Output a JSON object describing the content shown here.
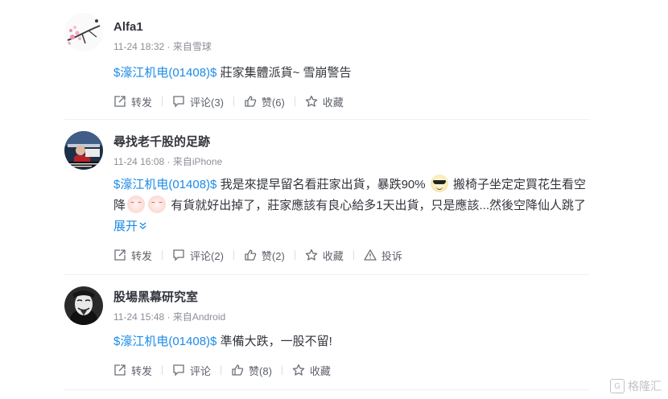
{
  "posts": [
    {
      "author": "Alfa1",
      "meta": "11-24 18:32 · 来自雪球",
      "stock": "$濠江机电(01408)$",
      "text_parts": [
        "莊家集體派貨~ 雪崩警告"
      ],
      "actions": {
        "repost": "转发",
        "comment": "评论(3)",
        "like": "赞(6)",
        "favorite": "收藏"
      }
    },
    {
      "author": "尋找老千股的足跡",
      "meta": "11-24 16:08 · 来自iPhone",
      "stock": "$濠江机电(01408)$",
      "text_parts": [
        "我是來提早留名看莊家出貨，暴跌90%",
        "搬椅子坐定定買花生看空降",
        "有貨就好出掉了，莊家應該有良心給多1天出貨，只是應該...然後空降仙人跳了"
      ],
      "expand": "展开",
      "actions": {
        "repost": "转发",
        "comment": "评论(2)",
        "like": "赞(2)",
        "favorite": "收藏",
        "report": "投诉"
      }
    },
    {
      "author": "股場黑幕研究室",
      "meta": "11-24 15:48 · 来自Android",
      "stock": "$濠江机电(01408)$",
      "text_parts": [
        "準備大跌，一股不留!"
      ],
      "actions": {
        "repost": "转发",
        "comment": "评论",
        "like": "赞(8)",
        "favorite": "收藏"
      }
    }
  ],
  "watermark": "格隆汇",
  "colors": {
    "link": "#1c8be6",
    "text": "#33353c",
    "meta": "#8b8f96",
    "divider": "#edf0f5"
  }
}
